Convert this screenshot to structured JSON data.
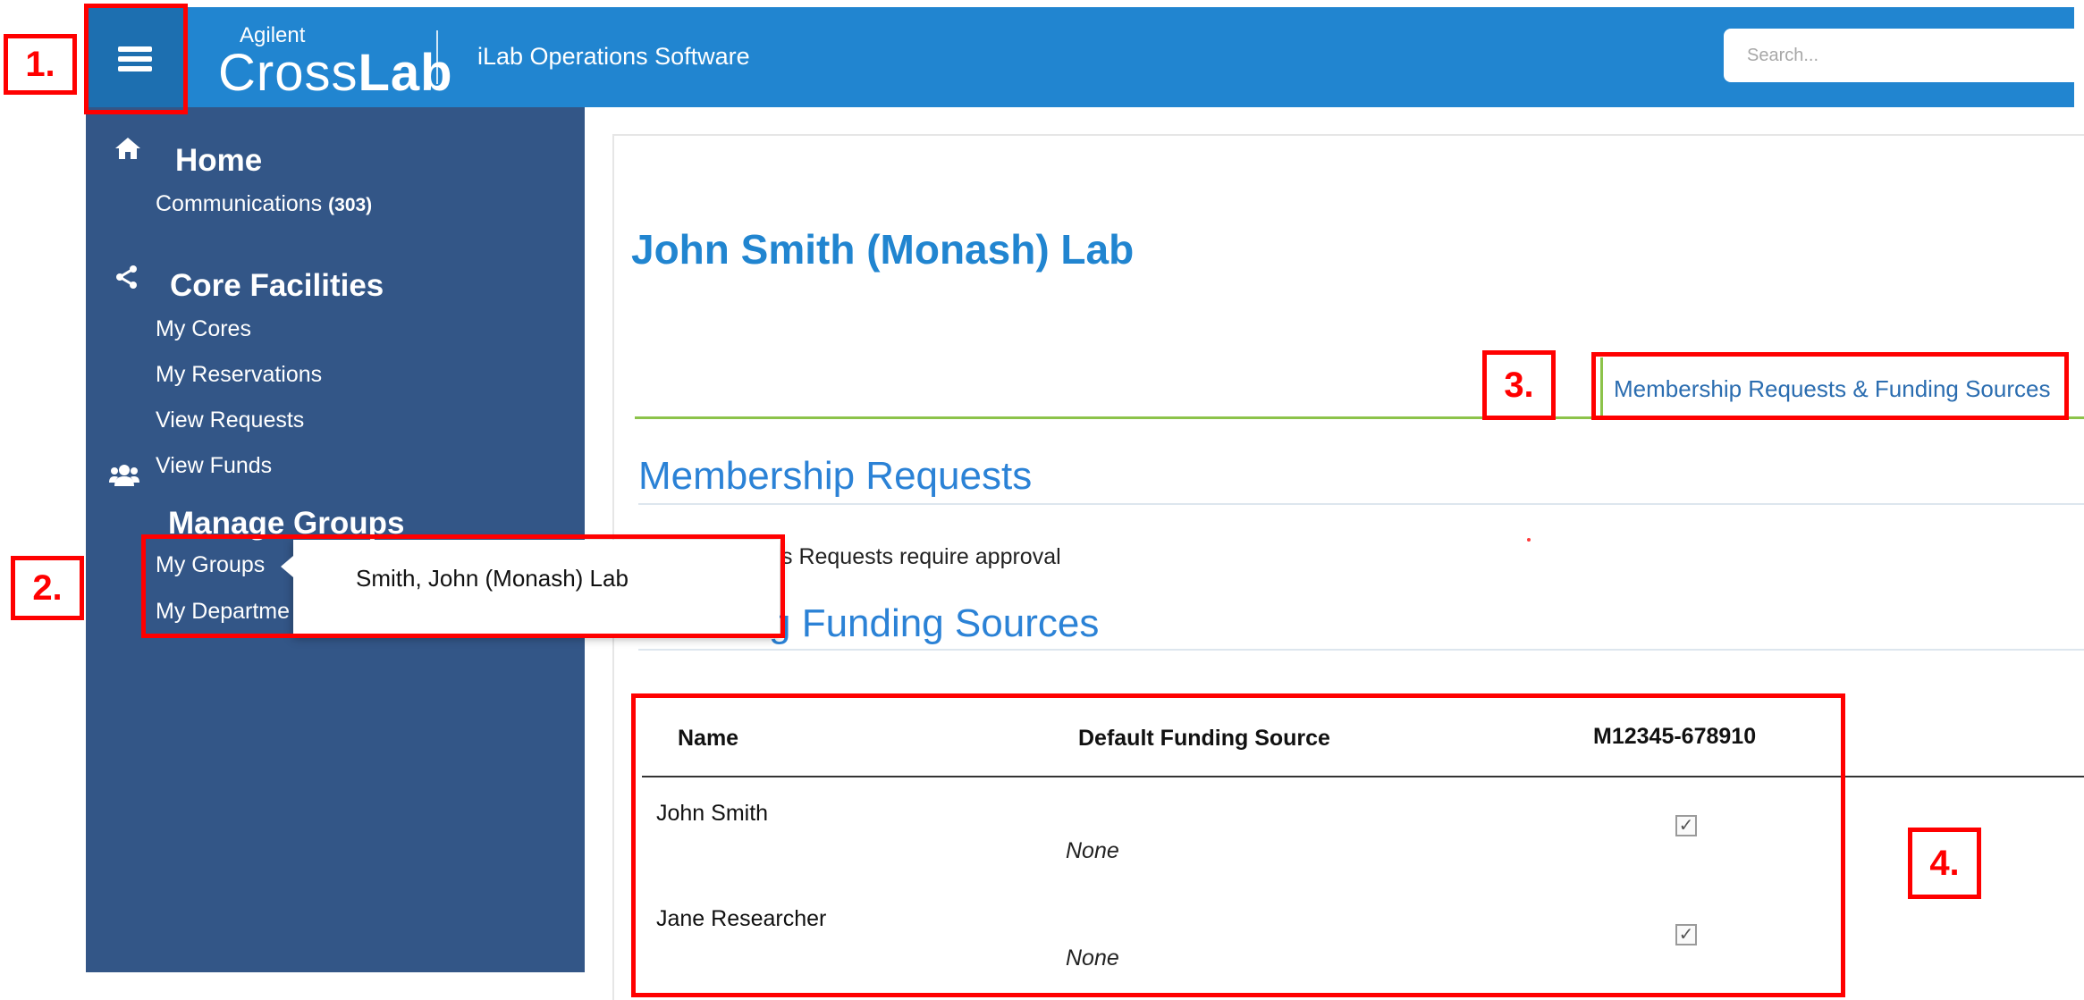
{
  "topbar": {
    "logo_small": "Agilent",
    "logo_cross": "Cross",
    "logo_lab": "Lab",
    "app_name": "iLab Operations Software",
    "search_placeholder": "Search...",
    "menu_icon": "hamburger-icon",
    "accent_color": "#2185d0"
  },
  "sidebar": {
    "background": "#335687",
    "sections": [
      {
        "icon": "home-icon",
        "title": "Home",
        "items": [
          {
            "label": "Communications",
            "count": "(303)"
          }
        ]
      },
      {
        "icon": "share-icon",
        "title": "Core Facilities",
        "items": [
          {
            "label": "My Cores"
          },
          {
            "label": "My Reservations"
          },
          {
            "label": "View Requests"
          },
          {
            "label": "View Funds"
          }
        ]
      },
      {
        "icon": "users-icon",
        "title": "Manage Groups",
        "items": [
          {
            "label": "My Groups"
          },
          {
            "label": "My Departme"
          }
        ]
      }
    ]
  },
  "popup": {
    "item": "Smith, John (Monash) Lab"
  },
  "main": {
    "lab_title": "John Smith (Monash) Lab",
    "tab_label": "Membership Requests & Funding Sources",
    "membership_title": "Membership Requests",
    "membership_note": "s Requests require approval",
    "funding_title": "g Funding Sources",
    "table": {
      "headers": [
        "Name",
        "Default Funding Source",
        "M12345-678910"
      ],
      "rows": [
        {
          "name": "John Smith",
          "default": "None",
          "checked": true
        },
        {
          "name": "Jane Researcher",
          "default": "None",
          "checked": true
        }
      ]
    }
  },
  "callouts": [
    "1.",
    "2.",
    "3.",
    "4."
  ]
}
